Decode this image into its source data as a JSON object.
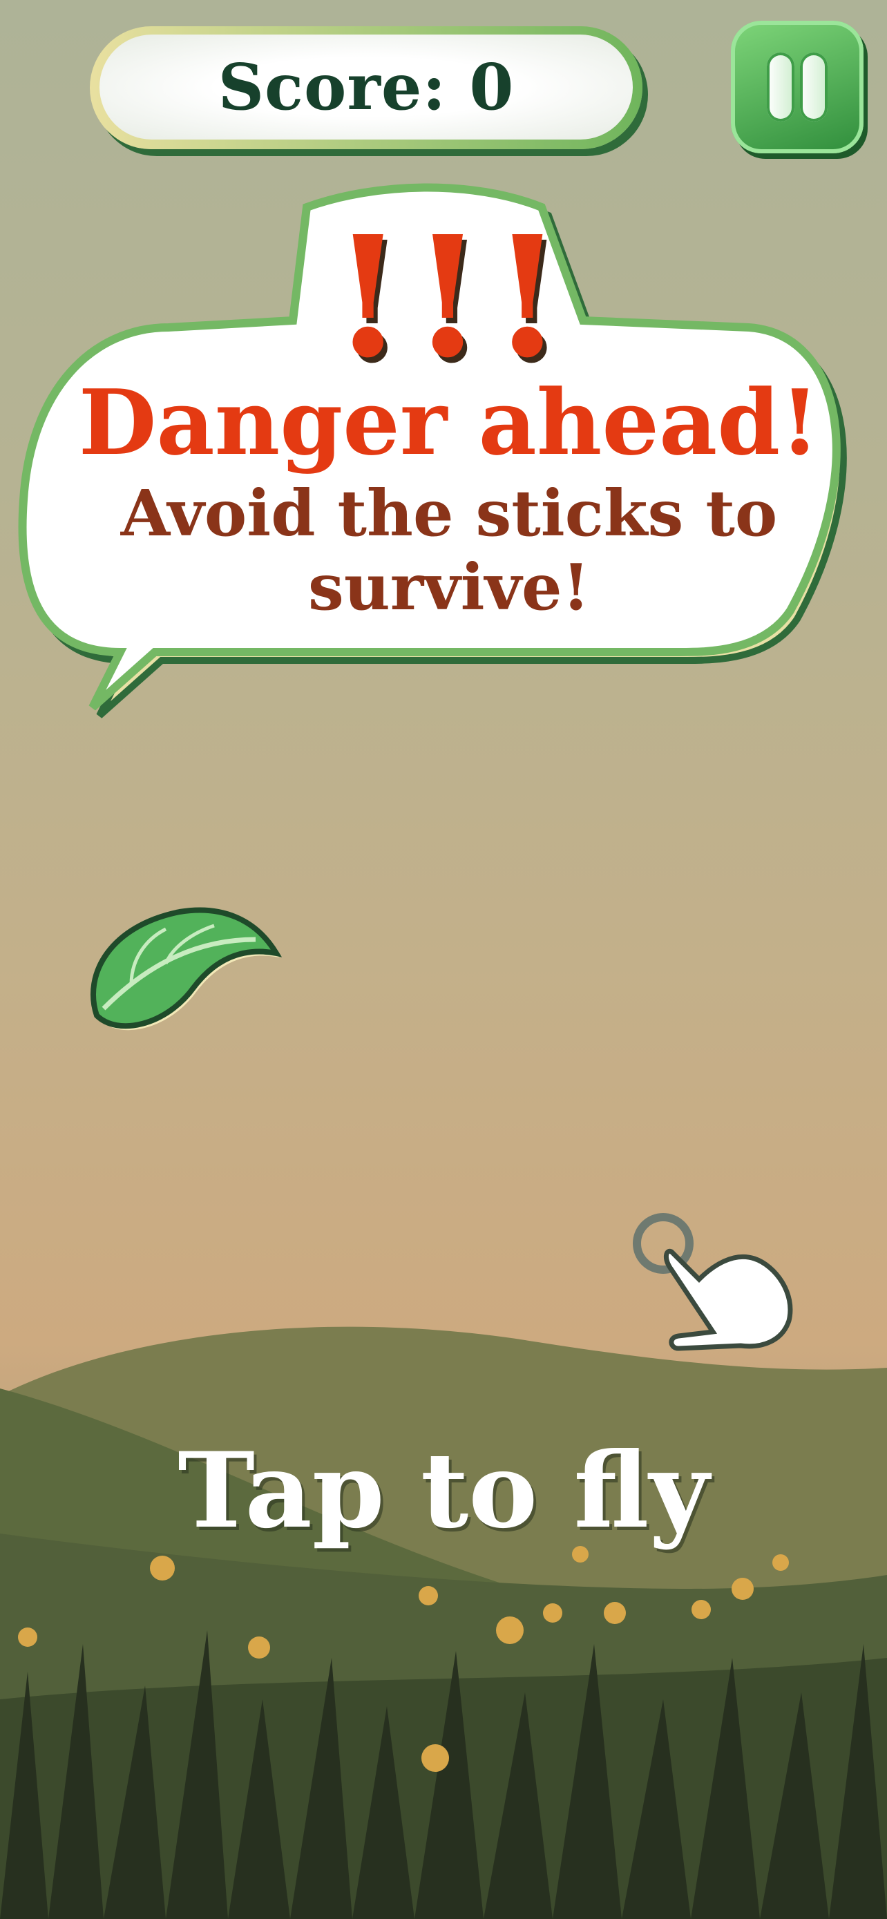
{
  "hud": {
    "score_label": "Score:",
    "score_value": 0,
    "score_text": "Score: 0",
    "pause_icon": "pause-icon"
  },
  "alert": {
    "icon_text": "!!!",
    "title": "Danger ahead!",
    "message": "Avoid the sticks to survive!"
  },
  "player": {
    "icon": "leaf-icon"
  },
  "hint": {
    "icon": "tap-hand-icon",
    "label": "Tap to fly"
  },
  "colors": {
    "accent_green": "#2f8d3b",
    "danger_red": "#e43a12",
    "message_brown": "#8a3419",
    "score_text": "#17412c"
  }
}
